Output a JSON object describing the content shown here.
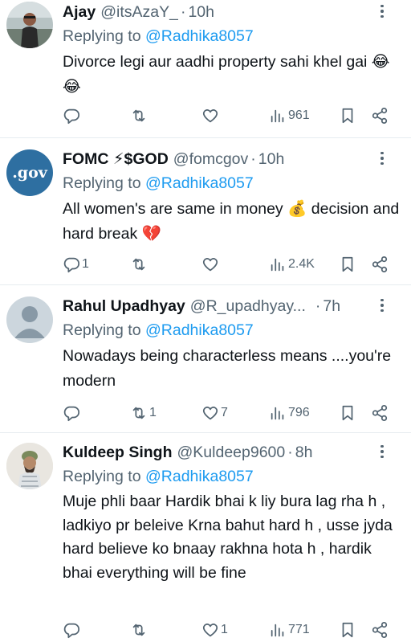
{
  "tweets": [
    {
      "name": "Ajay",
      "handle": "@itsAzaY_",
      "time": "10h",
      "replying_label": "Replying to",
      "replying_to": "@Radhika8057",
      "text": "Divorce legi aur aadhi property sahi khel gai 😂😂",
      "replies": "",
      "retweets": "",
      "likes": "",
      "views": "961"
    },
    {
      "name": "FOMC ⚡$GOD",
      "handle": "@fomcgov",
      "time": "10h",
      "avatar_text": ".gov",
      "replying_label": "Replying to",
      "replying_to": "@Radhika8057",
      "text": "All women's are same in money 💰 decision and hard break 💔",
      "replies": "1",
      "retweets": "",
      "likes": "",
      "views": "2.4K"
    },
    {
      "name": "Rahul Upadhyay",
      "handle": "@R_upadhyay...",
      "time": "7h",
      "replying_label": "Replying to",
      "replying_to": "@Radhika8057",
      "text": "Nowadays being characterless means ....you're modern",
      "replies": "",
      "retweets": "1",
      "likes": "7",
      "views": "796"
    },
    {
      "name": "Kuldeep Singh",
      "handle": "@Kuldeep9600",
      "time": "8h",
      "replying_label": "Replying to",
      "replying_to": "@Radhika8057",
      "text": "Muje phli baar Hardik bhai k liy bura lag rha h , ladkiyo pr beleive Krna bahut hard h , usse jyda hard believe ko bnaay rakhna hota h , hardik bhai everything will be fine",
      "replies": "",
      "retweets": "",
      "likes": "1",
      "views": "771"
    }
  ],
  "colors": {
    "text": "#0f1419",
    "secondary": "#536471",
    "link": "#1d9bf0",
    "divider": "#e6ecf0"
  }
}
